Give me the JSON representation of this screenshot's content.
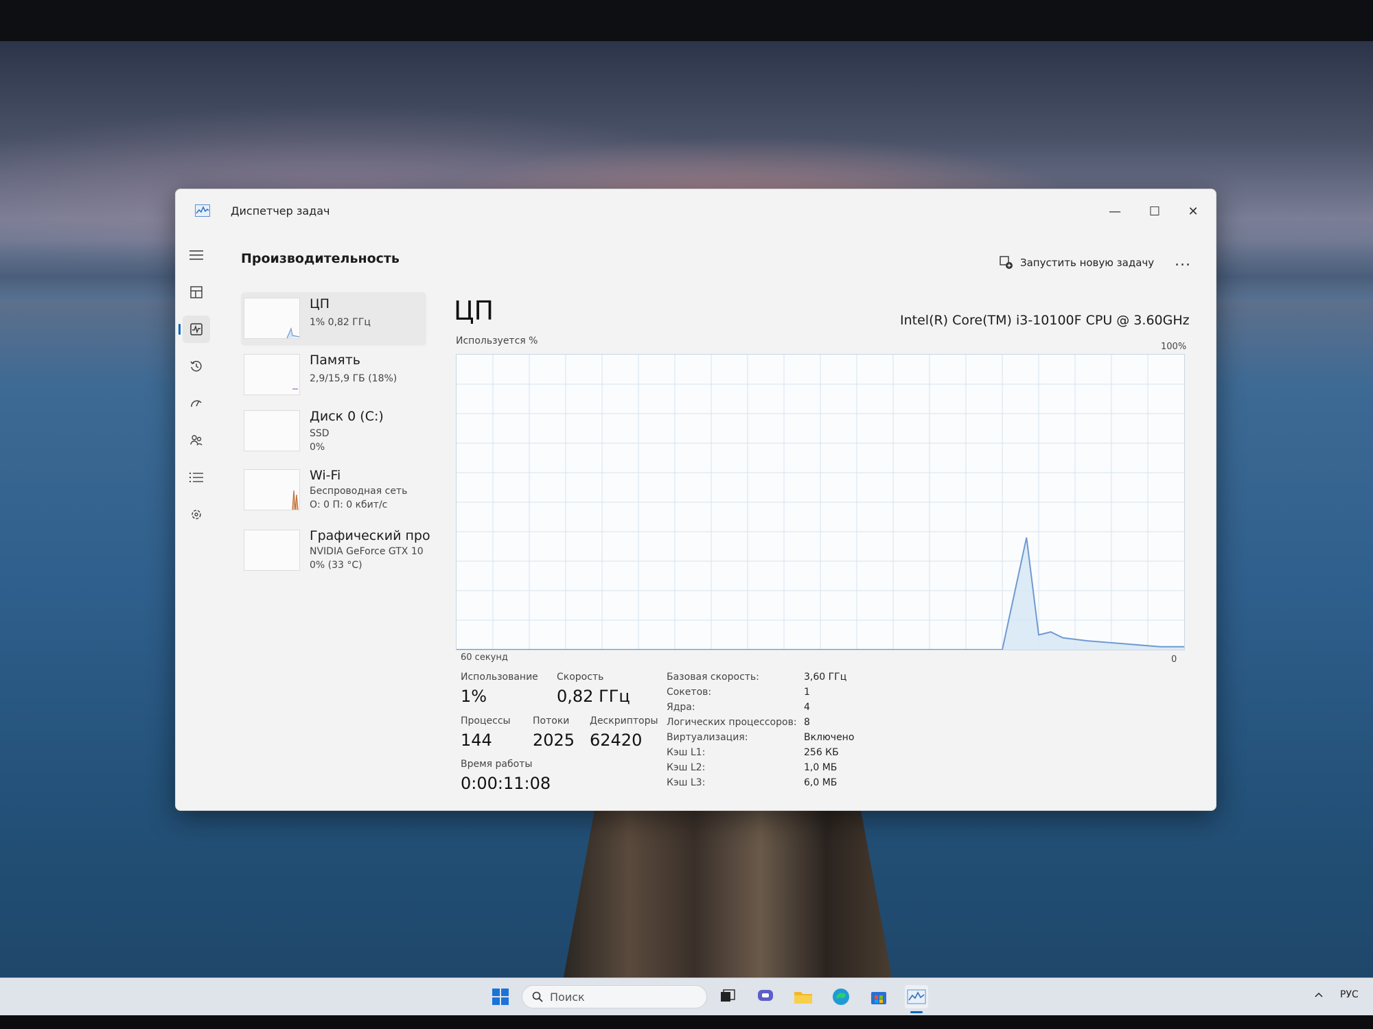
{
  "window": {
    "title": "Диспетчер задач",
    "page_title": "Производительность",
    "run_new_task": "Запустить новую задачу",
    "more_label": "...",
    "minimize_glyph": "—",
    "maximize_glyph": "☐",
    "close_glyph": "✕"
  },
  "nav": {
    "items": [
      {
        "icon": "hamburger-icon"
      },
      {
        "icon": "processes-icon"
      },
      {
        "icon": "performance-icon",
        "active": true
      },
      {
        "icon": "app-history-icon"
      },
      {
        "icon": "startup-apps-icon"
      },
      {
        "icon": "users-icon"
      },
      {
        "icon": "details-icon"
      },
      {
        "icon": "services-icon"
      }
    ],
    "settings_icon": "settings-gear-icon"
  },
  "resources": [
    {
      "name": "ЦП",
      "line1": "1% 0,82 ГГц",
      "line2": ""
    },
    {
      "name": "Память",
      "line1": "2,9/15,9 ГБ (18%)",
      "line2": ""
    },
    {
      "name": "Диск 0 (C:)",
      "line1": "SSD",
      "line2": "0%"
    },
    {
      "name": "Wi-Fi",
      "line1": "Беспроводная сеть",
      "line2": "О: 0 П: 0 кбит/с"
    },
    {
      "name": "Графический про",
      "line1": "NVIDIA GeForce GTX 10",
      "line2": "0% (33 °C)"
    }
  ],
  "cpu": {
    "title": "ЦП",
    "model": "Intel(R) Core(TM) i3-10100F CPU @ 3.60GHz",
    "usage_label": "Используется %",
    "max_label": "100%",
    "time_label": "60 секунд",
    "zero_label": "0",
    "stats": {
      "usage_label": "Использование",
      "usage": "1%",
      "speed_label": "Скорость",
      "speed": "0,82 ГГц",
      "processes_label": "Процессы",
      "processes": "144",
      "threads_label": "Потоки",
      "threads": "2025",
      "handles_label": "Дескрипторы",
      "handles": "62420",
      "uptime_label": "Время работы",
      "uptime": "0:00:11:08"
    },
    "specs": [
      {
        "key": "Базовая скорость:",
        "value": "3,60 ГГц"
      },
      {
        "key": "Сокетов:",
        "value": "1"
      },
      {
        "key": "Ядра:",
        "value": "4"
      },
      {
        "key": "Логических процессоров:",
        "value": "8"
      },
      {
        "key": "Виртуализация:",
        "value": "Включено"
      },
      {
        "key": "Кэш L1:",
        "value": "256 КБ"
      },
      {
        "key": "Кэш L2:",
        "value": "1,0 МБ"
      },
      {
        "key": "Кэш L3:",
        "value": "6,0 МБ"
      }
    ]
  },
  "chart_data": {
    "type": "area",
    "x": [
      0,
      45,
      47,
      48,
      49,
      50,
      52,
      55,
      58,
      60
    ],
    "values": [
      0,
      0,
      38,
      5,
      6,
      4,
      3,
      2,
      1,
      1
    ],
    "ylim": [
      0,
      100
    ],
    "xlim": [
      0,
      60
    ],
    "grid": true,
    "line_color": "#6f9ad1",
    "fill_color": "#d6e6f5",
    "grid_color": "#d7e3ef"
  },
  "taskbar": {
    "search_placeholder": "Поиск",
    "language": "РУС",
    "icons": [
      "windows-start-icon",
      "task-view-icon",
      "chat-icon",
      "file-explorer-icon",
      "edge-icon",
      "store-icon",
      "task-manager-icon"
    ]
  }
}
